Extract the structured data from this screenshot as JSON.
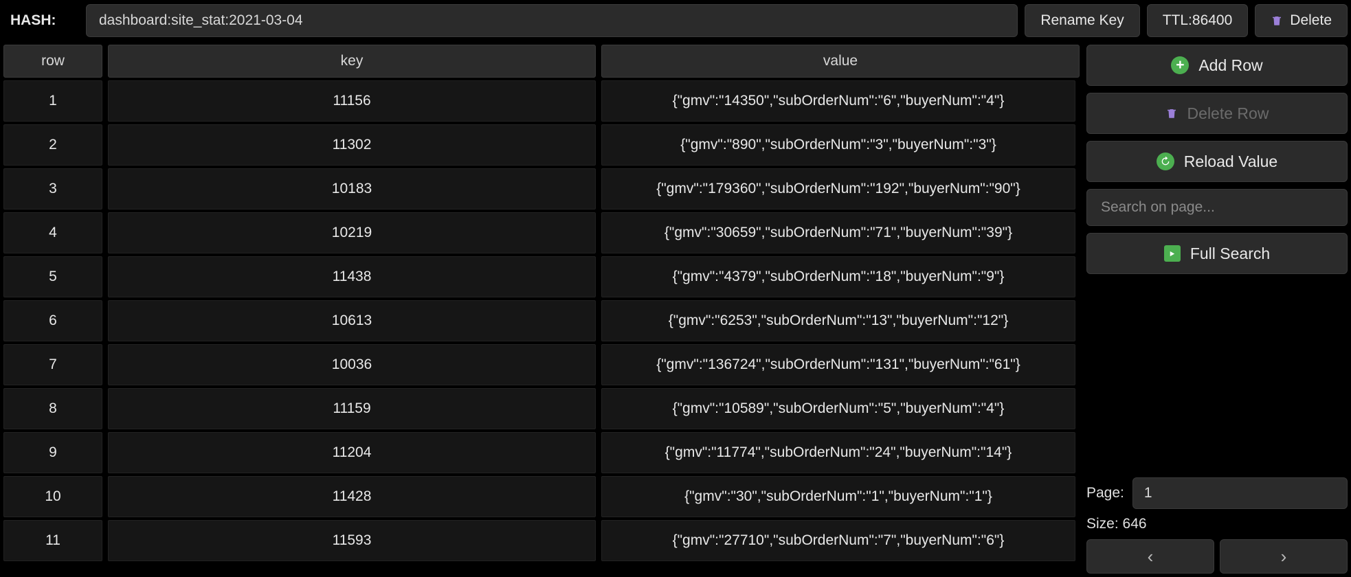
{
  "header": {
    "type_label": "HASH:",
    "key_value": "dashboard:site_stat:2021-03-04",
    "rename_label": "Rename Key",
    "ttl_label": "TTL:86400",
    "delete_label": "Delete"
  },
  "table": {
    "headers": {
      "row": "row",
      "key": "key",
      "value": "value"
    },
    "rows": [
      {
        "row": "1",
        "key": "11156",
        "value": "{\"gmv\":\"14350\",\"subOrderNum\":\"6\",\"buyerNum\":\"4\"}"
      },
      {
        "row": "2",
        "key": "11302",
        "value": "{\"gmv\":\"890\",\"subOrderNum\":\"3\",\"buyerNum\":\"3\"}"
      },
      {
        "row": "3",
        "key": "10183",
        "value": "{\"gmv\":\"179360\",\"subOrderNum\":\"192\",\"buyerNum\":\"90\"}"
      },
      {
        "row": "4",
        "key": "10219",
        "value": "{\"gmv\":\"30659\",\"subOrderNum\":\"71\",\"buyerNum\":\"39\"}"
      },
      {
        "row": "5",
        "key": "11438",
        "value": "{\"gmv\":\"4379\",\"subOrderNum\":\"18\",\"buyerNum\":\"9\"}"
      },
      {
        "row": "6",
        "key": "10613",
        "value": "{\"gmv\":\"6253\",\"subOrderNum\":\"13\",\"buyerNum\":\"12\"}"
      },
      {
        "row": "7",
        "key": "10036",
        "value": "{\"gmv\":\"136724\",\"subOrderNum\":\"131\",\"buyerNum\":\"61\"}"
      },
      {
        "row": "8",
        "key": "11159",
        "value": "{\"gmv\":\"10589\",\"subOrderNum\":\"5\",\"buyerNum\":\"4\"}"
      },
      {
        "row": "9",
        "key": "11204",
        "value": "{\"gmv\":\"11774\",\"subOrderNum\":\"24\",\"buyerNum\":\"14\"}"
      },
      {
        "row": "10",
        "key": "11428",
        "value": "{\"gmv\":\"30\",\"subOrderNum\":\"1\",\"buyerNum\":\"1\"}"
      },
      {
        "row": "11",
        "key": "11593",
        "value": "{\"gmv\":\"27710\",\"subOrderNum\":\"7\",\"buyerNum\":\"6\"}"
      }
    ]
  },
  "sidebar": {
    "add_row_label": "Add Row",
    "delete_row_label": "Delete Row",
    "reload_label": "Reload Value",
    "search_placeholder": "Search on page...",
    "full_search_label": "Full Search"
  },
  "pager": {
    "page_label": "Page:",
    "page_value": "1",
    "size_label": "Size: ",
    "size_value": "646",
    "prev_label": "‹",
    "next_label": "›"
  }
}
